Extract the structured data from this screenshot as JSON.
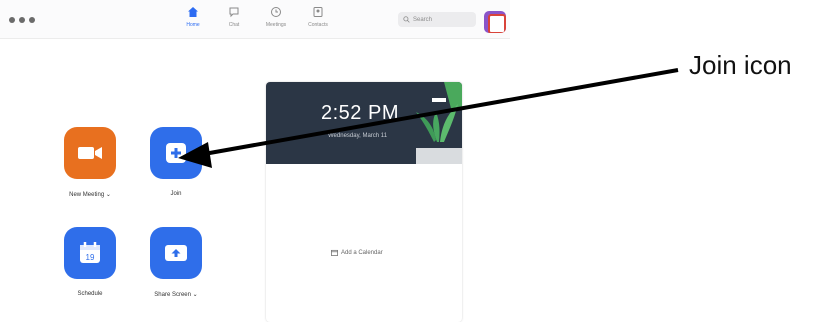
{
  "nav": {
    "home": "Home",
    "chat": "Chat",
    "meetings": "Meetings",
    "contacts": "Contacts"
  },
  "search": {
    "placeholder": "Search"
  },
  "actions": {
    "new_meeting": "New Meeting ⌄",
    "join": "Join",
    "schedule": "Schedule",
    "share_screen": "Share Screen ⌄"
  },
  "calendar": {
    "time": "2:52 PM",
    "date": "Wednesday, March 11",
    "add_calendar": "Add a Calendar",
    "schedule_day": "19"
  },
  "annotation": {
    "label": "Join icon"
  },
  "colors": {
    "accent_blue": "#2f6eea",
    "new_meeting_orange": "#e8701f",
    "banner_dark": "#2b3645"
  }
}
